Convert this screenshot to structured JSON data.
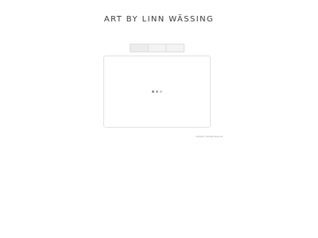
{
  "header": {
    "title": "ART BY LINN WÄSSING"
  },
  "nav": {
    "items": [
      {
        "label": ""
      },
      {
        "label": ""
      },
      {
        "label": ""
      }
    ]
  },
  "gallery": {
    "loading_indicator": "loading-dots"
  },
  "footer": {
    "copyright": "Copyright © All Rights Reserved"
  }
}
